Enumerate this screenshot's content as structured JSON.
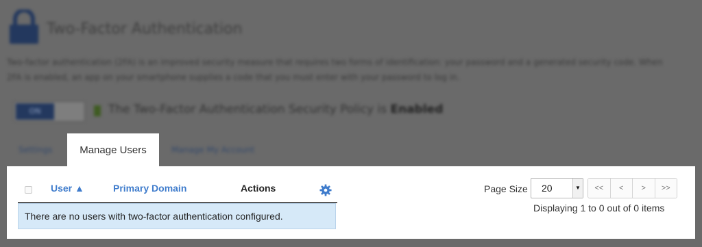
{
  "background": {
    "title": "Two-Factor Authentication",
    "description": "Two-factor authentication (2FA) is an improved security measure that requires two forms of identification: your password and a generated security code. When 2FA is enabled, an app on your smartphone supplies a code that you must enter with your password to log in.",
    "toggle_on_label": "ON",
    "policy_text": "The Two-Factor Authentication Security Policy is",
    "policy_status": "Enabled",
    "tabs": [
      "Settings",
      "Manage My Account"
    ]
  },
  "active_tab": "Manage Users",
  "table": {
    "columns": [
      "User ▲",
      "Primary Domain",
      "Actions"
    ],
    "empty_message": "There are no users with two-factor authentication configured."
  },
  "pagination": {
    "page_size_label": "Page Size",
    "page_size_value": "20",
    "buttons": [
      "<<",
      "<",
      ">",
      ">>"
    ],
    "displaying": "Displaying 1 to 0 out of 0 items"
  },
  "colors": {
    "link": "#3f7ccc",
    "highlight": "#d6e9f8",
    "overlay": "#6a6a6a"
  }
}
